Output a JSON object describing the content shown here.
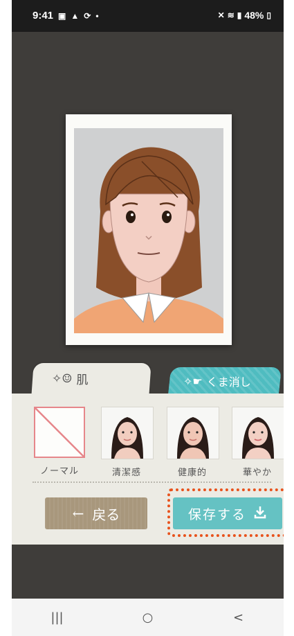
{
  "status": {
    "time": "9:41",
    "battery": "48%",
    "left_icons": [
      "image-icon",
      "warning-icon",
      "sync-icon",
      "dot-icon"
    ],
    "right_icons": [
      "mute-icon",
      "wifi-icon",
      "signal-icon",
      "battery-icon"
    ]
  },
  "tabs": {
    "skin": "肌",
    "kuma": "くま消し"
  },
  "filters": [
    {
      "label": "ノーマル"
    },
    {
      "label": "清潔感"
    },
    {
      "label": "健康的"
    },
    {
      "label": "華やか"
    }
  ],
  "buttons": {
    "back_arrow": "←",
    "back": "戻る",
    "save": "保存する"
  },
  "nav": {
    "recents": "|||",
    "home": "○",
    "back": "<"
  },
  "colors": {
    "background": "#3f3d3a",
    "accent_teal": "#65c2c3",
    "highlight": "#e8521c",
    "back_button": "#a8977c"
  }
}
